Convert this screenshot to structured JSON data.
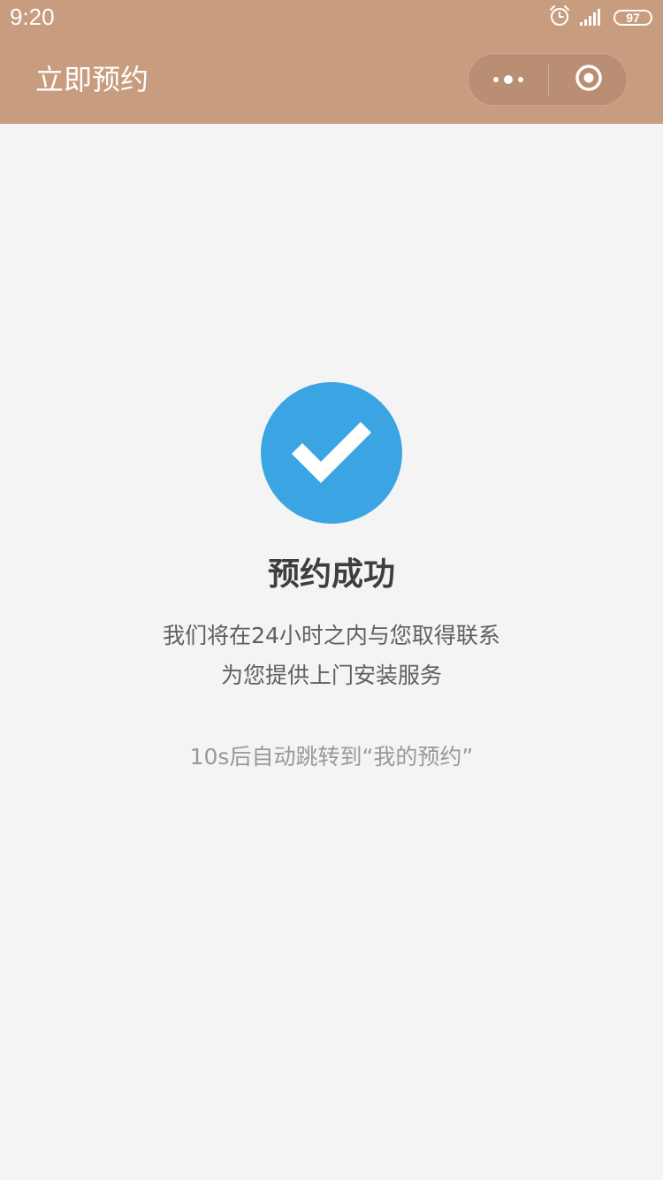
{
  "status_bar": {
    "time": "9:20",
    "battery": "97"
  },
  "nav": {
    "title": "立即预约"
  },
  "success": {
    "title": "预约成功",
    "desc_line1": "我们将在24小时之内与您取得联系",
    "desc_line2": "为您提供上门安装服务",
    "redirect_hint": "10s后自动跳转到“我的预约”",
    "icon_color": "#3ba5e3"
  },
  "colors": {
    "header": "#c89c7e",
    "background": "#f4f4f4"
  }
}
